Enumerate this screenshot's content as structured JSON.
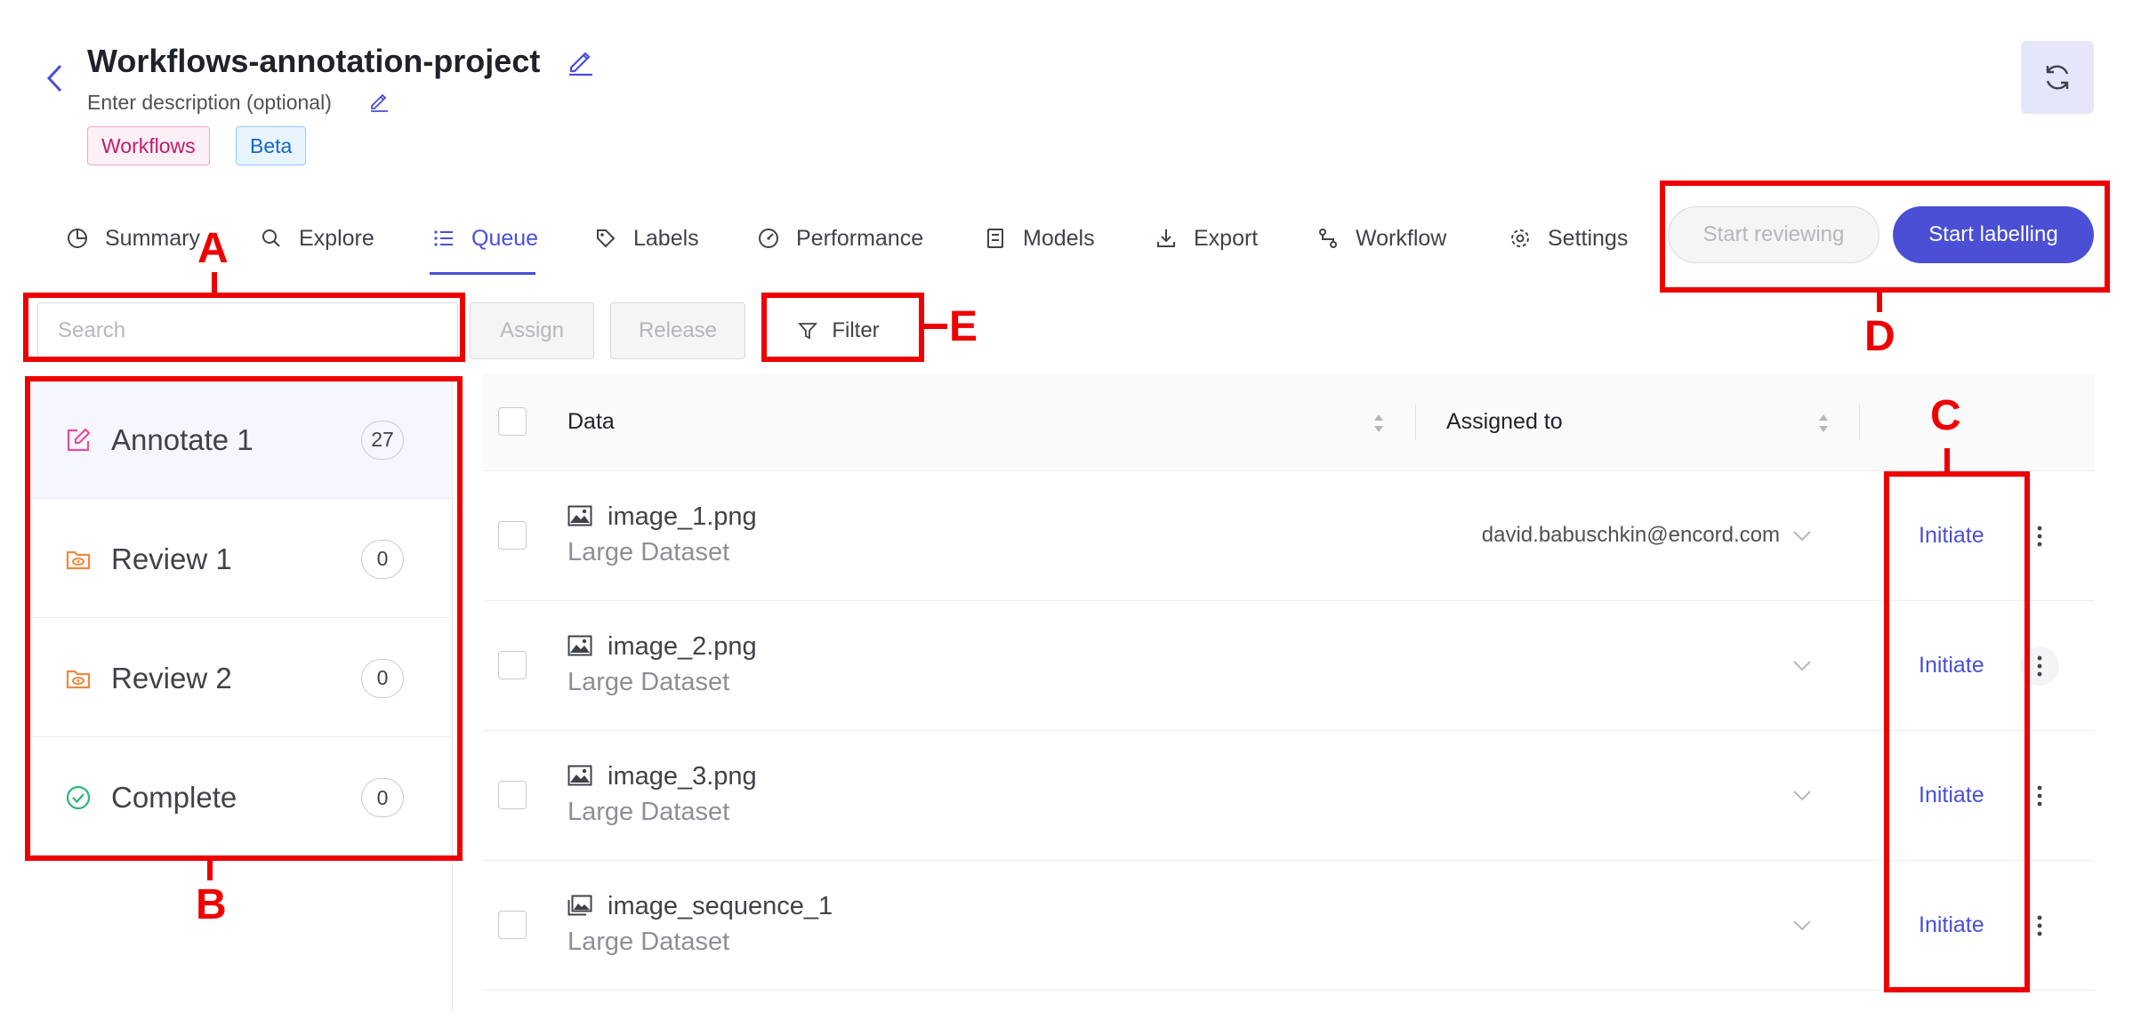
{
  "project": {
    "title": "Workflows-annotation-project",
    "description": "Enter description (optional)",
    "tags": [
      "Workflows",
      "Beta"
    ]
  },
  "tabs": [
    {
      "label": "Summary",
      "icon": "pie-chart-icon"
    },
    {
      "label": "Explore",
      "icon": "search-icon"
    },
    {
      "label": "Queue",
      "icon": "list-icon",
      "active": true
    },
    {
      "label": "Labels",
      "icon": "tag-icon"
    },
    {
      "label": "Performance",
      "icon": "gauge-icon"
    },
    {
      "label": "Models",
      "icon": "model-icon"
    },
    {
      "label": "Export",
      "icon": "download-icon"
    },
    {
      "label": "Workflow",
      "icon": "workflow-icon"
    },
    {
      "label": "Settings",
      "icon": "gear-icon"
    }
  ],
  "actions": {
    "start_reviewing": "Start reviewing",
    "start_labelling": "Start labelling"
  },
  "toolbar": {
    "search_placeholder": "Search",
    "assign": "Assign",
    "release": "Release",
    "filter": "Filter"
  },
  "stages": [
    {
      "label": "Annotate 1",
      "count": "27",
      "icon": "edit-square-icon"
    },
    {
      "label": "Review 1",
      "count": "0",
      "icon": "folder-eye-icon"
    },
    {
      "label": "Review 2",
      "count": "0",
      "icon": "folder-eye-icon"
    },
    {
      "label": "Complete",
      "count": "0",
      "icon": "check-circle-icon"
    }
  ],
  "table": {
    "columns": [
      "Data",
      "Assigned to"
    ],
    "rows": [
      {
        "name": "image_1.png",
        "dataset": "Large Dataset",
        "assignee": "david.babuschkin@encord.com",
        "action": "Initiate",
        "icon": "image-icon"
      },
      {
        "name": "image_2.png",
        "dataset": "Large Dataset",
        "assignee": "",
        "action": "Initiate",
        "icon": "image-icon"
      },
      {
        "name": "image_3.png",
        "dataset": "Large Dataset",
        "assignee": "",
        "action": "Initiate",
        "icon": "image-icon"
      },
      {
        "name": "image_sequence_1",
        "dataset": "Large Dataset",
        "assignee": "",
        "action": "Initiate",
        "icon": "image-sequence-icon"
      }
    ]
  },
  "annotations": {
    "a": "A",
    "b": "B",
    "c": "C",
    "d": "D",
    "e": "E"
  },
  "colors": {
    "accent": "#4a4fd6",
    "annotation_red": "#ee0000",
    "workflows_tag": "#c4196b",
    "beta_tag": "#1467c9",
    "review_icon": "#f0883e",
    "complete_icon": "#2bb673",
    "annotate_icon": "#e64d9a"
  }
}
